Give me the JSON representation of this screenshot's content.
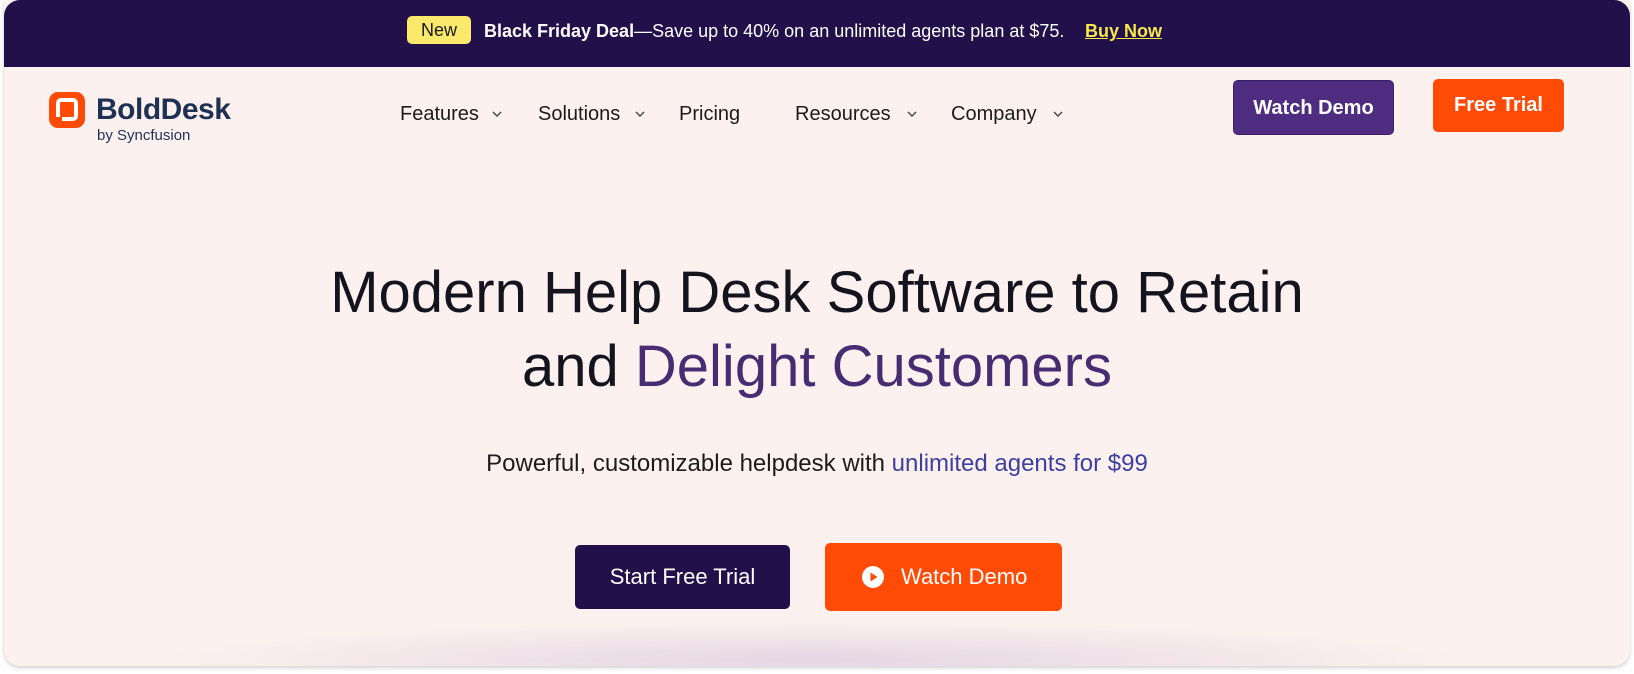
{
  "banner": {
    "badge": "New",
    "deal_title": "Black Friday Deal",
    "deal_text": "—Save up to 40% on an unlimited agents plan at $75.",
    "link": "Buy Now",
    "bg_color": "#22104a",
    "badge_color": "#fbe96b"
  },
  "logo": {
    "word_bold": "Bold",
    "word_rest": "Desk",
    "sub": "by Syncfusion",
    "icon": "bolddesk-logo-icon",
    "color": "#1f3153",
    "mark_color": "#ff4b05"
  },
  "nav": {
    "features": "Features",
    "solutions": "Solutions",
    "pricing": "Pricing",
    "resources": "Resources",
    "company": "Company",
    "dropdown_icon": "chevron-down-icon"
  },
  "header_actions": {
    "watch_demo": "Watch Demo",
    "free_trial": "Free Trial"
  },
  "hero": {
    "title_line1": "Modern Help Desk Software to Retain",
    "title_line2_plain": "and ",
    "title_line2_accent": "Delight Customers",
    "subtitle_plain": "Powerful, customizable helpdesk with ",
    "subtitle_accent": "unlimited agents for $99",
    "start_trial": "Start Free Trial",
    "watch_demo": "Watch Demo",
    "play_icon": "play-icon",
    "accent_color": "#472c72",
    "cta_color": "#ff4b05"
  }
}
